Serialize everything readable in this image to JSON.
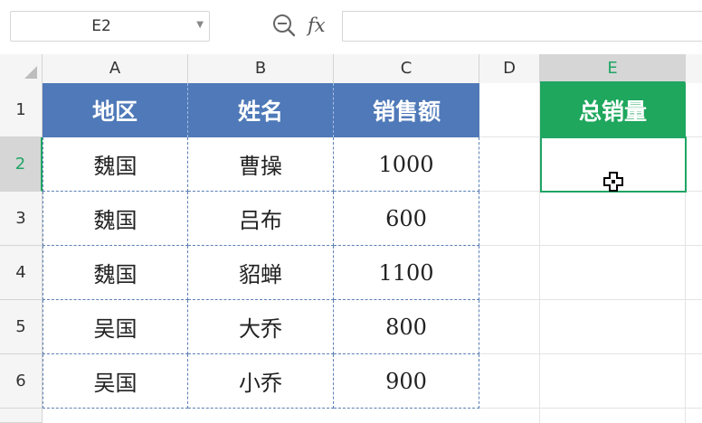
{
  "formula_bar": {
    "name_box": "E2",
    "formula_value": ""
  },
  "icons": {
    "zoom": "zoom-formula-icon",
    "fx": "fx",
    "cursor": "cell-select-cursor-icon"
  },
  "columns": [
    "A",
    "B",
    "C",
    "D",
    "E"
  ],
  "rows": [
    "1",
    "2",
    "3",
    "4",
    "5",
    "6"
  ],
  "table": {
    "headers": [
      "地区",
      "姓名",
      "销售额"
    ],
    "rows": [
      [
        "魏国",
        "曹操",
        "1000"
      ],
      [
        "魏国",
        "吕布",
        "600"
      ],
      [
        "魏国",
        "貂蝉",
        "1100"
      ],
      [
        "吴国",
        "大乔",
        "800"
      ],
      [
        "吴国",
        "小乔",
        "900"
      ]
    ]
  },
  "total": {
    "header": "总销量",
    "value": ""
  },
  "selection": {
    "cell": "E2",
    "column": "E",
    "row": "2"
  },
  "colors": {
    "table_header": "#4f79b8",
    "total_header": "#1ea75d",
    "selection": "#1fa564"
  }
}
